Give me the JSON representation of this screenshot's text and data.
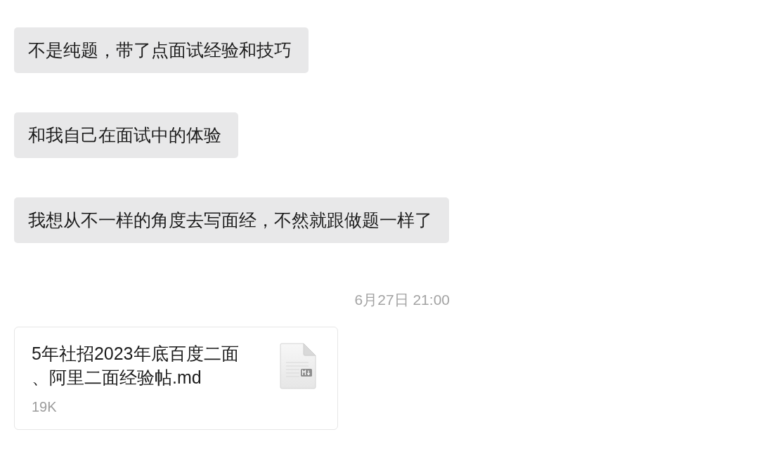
{
  "messages": [
    {
      "kind": "text",
      "text": "不是纯题，带了点面试经验和技巧"
    },
    {
      "kind": "text",
      "text": "和我自己在面试中的体验"
    },
    {
      "kind": "text",
      "text": "我想从不一样的角度去写面经，不然就跟做题一样了"
    },
    {
      "kind": "timestamp",
      "text": "6月27日 21:00"
    },
    {
      "kind": "file",
      "name": "5年社招2023年底百度二面、阿里二面经验帖.md",
      "size": "19K"
    }
  ]
}
